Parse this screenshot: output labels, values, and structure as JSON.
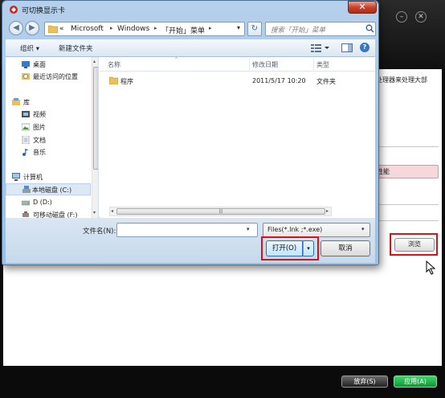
{
  "dialog": {
    "title": "可切换显示卡",
    "close_glyph": "✕",
    "nav": {
      "back_glyph": "◀",
      "forward_glyph": "▶",
      "breadcrumb": [
        "«",
        "Microsoft",
        "Windows",
        "「开始」菜单"
      ],
      "crumb_separators": [
        "▸",
        "▸",
        "▸"
      ],
      "address_dropdown_glyph": "▾",
      "refresh_glyph": "↻",
      "search_placeholder": "搜索「开始」菜单"
    },
    "toolbar": {
      "organize": "组织 ▾",
      "new_folder": "新建文件夹",
      "help_glyph": "?"
    },
    "nav_pane": [
      {
        "label": "桌面",
        "icon": "desktop-icon"
      },
      {
        "label": "最近访问的位置",
        "icon": "recent-places-icon"
      },
      {
        "label": "库",
        "icon": "library-icon"
      },
      {
        "label": "视频",
        "icon": "video-icon"
      },
      {
        "label": "图片",
        "icon": "pictures-icon"
      },
      {
        "label": "文档",
        "icon": "documents-icon"
      },
      {
        "label": "音乐",
        "icon": "music-icon"
      },
      {
        "label": "计算机",
        "icon": "computer-icon"
      },
      {
        "label": "本地磁盘 (C:)",
        "icon": "local-disk-icon",
        "selected": true
      },
      {
        "label": "D (D:)",
        "icon": "drive-icon"
      },
      {
        "label": "可移动磁盘 (F:)",
        "icon": "removable-disk-icon"
      }
    ],
    "columns": {
      "name": "名称",
      "modified": "修改日期",
      "type": "类型"
    },
    "sort_indicator": "^",
    "files": [
      {
        "name": "程序",
        "modified": "2011/5/17 10:20",
        "type": "文件夹"
      }
    ],
    "scroll": {
      "left_glyph": "◂",
      "right_glyph": "▸",
      "grip": "|||",
      "up_glyph": "▴",
      "down_glyph": "▾"
    },
    "filename_label": "文件名(N):",
    "filename_value": "",
    "filename_dropdown_glyph": "▾",
    "filter": "Files(*.lnk ;*.exe)",
    "filter_dropdown_glyph": "▾",
    "open_button": "打开(O)",
    "open_split_glyph": "▾",
    "cancel_button": "取消"
  },
  "background_app": {
    "window_buttons": [
      "–",
      "✕"
    ],
    "description_fragment": "块处理器来处理大部",
    "field_fragment": "性能",
    "browse_button": "浏览",
    "cancel_button": "放弃(S)",
    "apply_button": "应用(A)"
  },
  "colors": {
    "highlight_red": "#d4141a",
    "apply_green": "#22b04b",
    "dialog_frame": "#b5d0ec"
  }
}
